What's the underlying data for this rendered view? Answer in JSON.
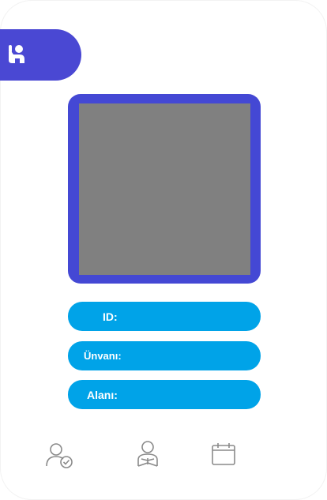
{
  "header": {
    "icon": "raised-hand-user-icon"
  },
  "photo": {
    "placeholder_color": "#808080",
    "frame_color": "#4448d4"
  },
  "fields": {
    "id_label": "ID:",
    "id_value": "",
    "title_label": "Ünvanı:",
    "title_value": "",
    "field_label": "Alanı:",
    "field_value": ""
  },
  "nav": {
    "items": [
      {
        "icon": "user-check-icon"
      },
      {
        "icon": "user-reading-icon"
      },
      {
        "icon": "calendar-icon"
      }
    ]
  },
  "colors": {
    "accent": "#4a48d3",
    "pill": "#00a3e8",
    "nav_icon": "#8a8a8a"
  }
}
